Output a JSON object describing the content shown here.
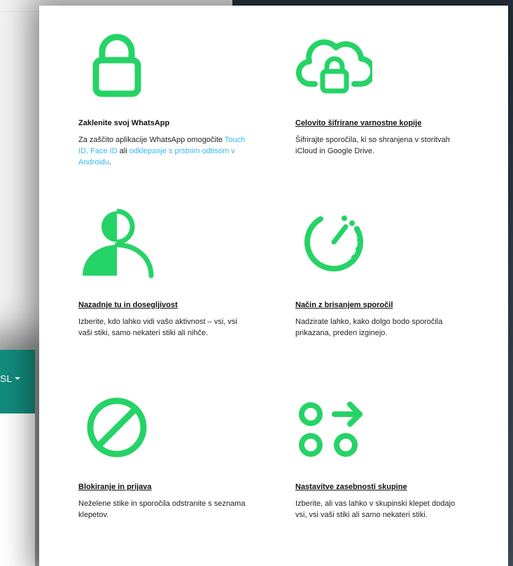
{
  "third_window": {
    "language_label": "SL"
  },
  "features": [
    {
      "title": "Zaklenite svoj WhatsApp",
      "desc_parts": [
        "Za zaščito aplikacije WhatsApp omogočite ",
        "Touch ID, Face ID",
        " ali ",
        "odklepanje s prstnim odtisom v Androidu",
        "."
      ],
      "icon": "padlock-icon"
    },
    {
      "title": "Celovito šifrirane varnostne kopije",
      "desc": "Šifrirajte sporočila, ki so shranjena v storitvah iCloud in Google Drive.",
      "icon": "cloud-lock-icon"
    },
    {
      "title": "Nazadnje tu in dosegljivost",
      "desc": "Izberite, kdo lahko vidi vašo aktivnost – vsi, vsi vaši stiki, samo nekateri stiki ali nihče.",
      "icon": "person-half-icon"
    },
    {
      "title": "Način z brisanjem sporočil",
      "desc": "Nadzirate lahko, kako dolgo bodo sporočila prikazana, preden izginejo.",
      "icon": "timer-icon"
    },
    {
      "title": "Blokiranje in prijava",
      "desc": "Neželene stike in sporočila odstranite s seznama klepetov.",
      "icon": "block-icon"
    },
    {
      "title": "Nastavitve zasebnosti skupine",
      "desc": "Izberite, ali vas lahko v skupinski klepet dodajo vsi, vsi vaši stiki ali samo nekateri stiki.",
      "icon": "group-arrow-icon"
    }
  ],
  "colors": {
    "accent": "#25d366",
    "link": "#34b7f1",
    "teal": "#128c7e"
  }
}
